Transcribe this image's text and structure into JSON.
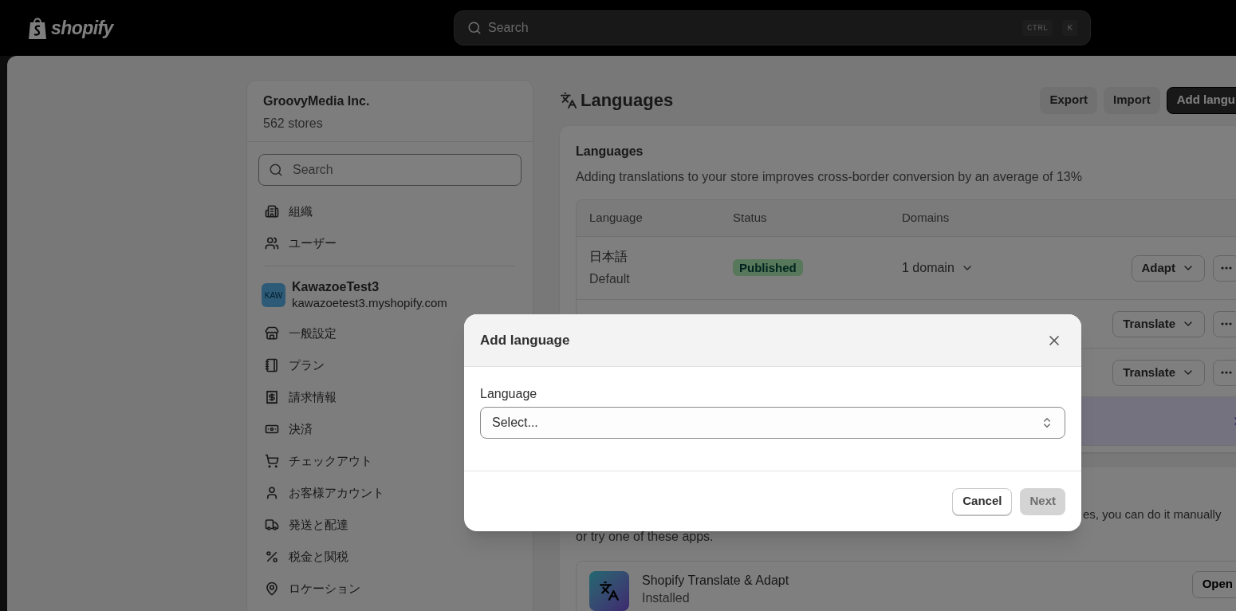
{
  "topbar": {
    "logo": "shopify",
    "search": {
      "placeholder": "Search"
    },
    "shortcut": [
      "CTRL",
      "K"
    ]
  },
  "sidebar": {
    "org": {
      "name": "GroovyMedia Inc.",
      "count": "562 stores"
    },
    "search": {
      "placeholder": "Search"
    },
    "org_items": [
      {
        "label": "組織"
      },
      {
        "label": "ユーザー"
      }
    ],
    "store": {
      "badge": "KAW",
      "name": "KawazoeTest3",
      "domain": "kawazoetest3.myshopify.com"
    },
    "items": [
      {
        "label": "一般設定"
      },
      {
        "label": "プラン"
      },
      {
        "label": "請求情報"
      },
      {
        "label": "決済"
      },
      {
        "label": "チェックアウト"
      },
      {
        "label": "お客様アカウント"
      },
      {
        "label": "発送と配達"
      },
      {
        "label": "税金と関税"
      },
      {
        "label": "ロケーション"
      }
    ]
  },
  "page": {
    "title": "Languages",
    "actions": [
      {
        "label": "Export",
        "kind": "secondary"
      },
      {
        "label": "Import",
        "kind": "secondary"
      },
      {
        "label": "Add langu",
        "kind": "primary"
      }
    ]
  },
  "languages_card": {
    "title": "Languages",
    "description": "Adding translations to your store improves cross-border conversion by an average of 13%",
    "columns": [
      "Language",
      "Status",
      "Domains"
    ],
    "rows": [
      {
        "language": "日本語",
        "note": "Default",
        "status": "Published",
        "domains": "1 domain",
        "action": "Adapt"
      },
      {
        "action": "Translate"
      },
      {
        "action": "Translate"
      }
    ]
  },
  "apps_card": {
    "text_line_1": "es, you can do it manually",
    "text_line_2": "or try one of these apps.",
    "apps": [
      {
        "name": "Shopify Translate & Adapt",
        "status": "Installed",
        "action": "Open"
      }
    ]
  },
  "modal": {
    "title": "Add language",
    "field": {
      "label": "Language",
      "placeholder": "Select..."
    },
    "buttons": [
      {
        "label": "Cancel",
        "kind": "secondary",
        "disabled": false
      },
      {
        "label": "Next",
        "kind": "primary",
        "disabled": true
      }
    ]
  }
}
